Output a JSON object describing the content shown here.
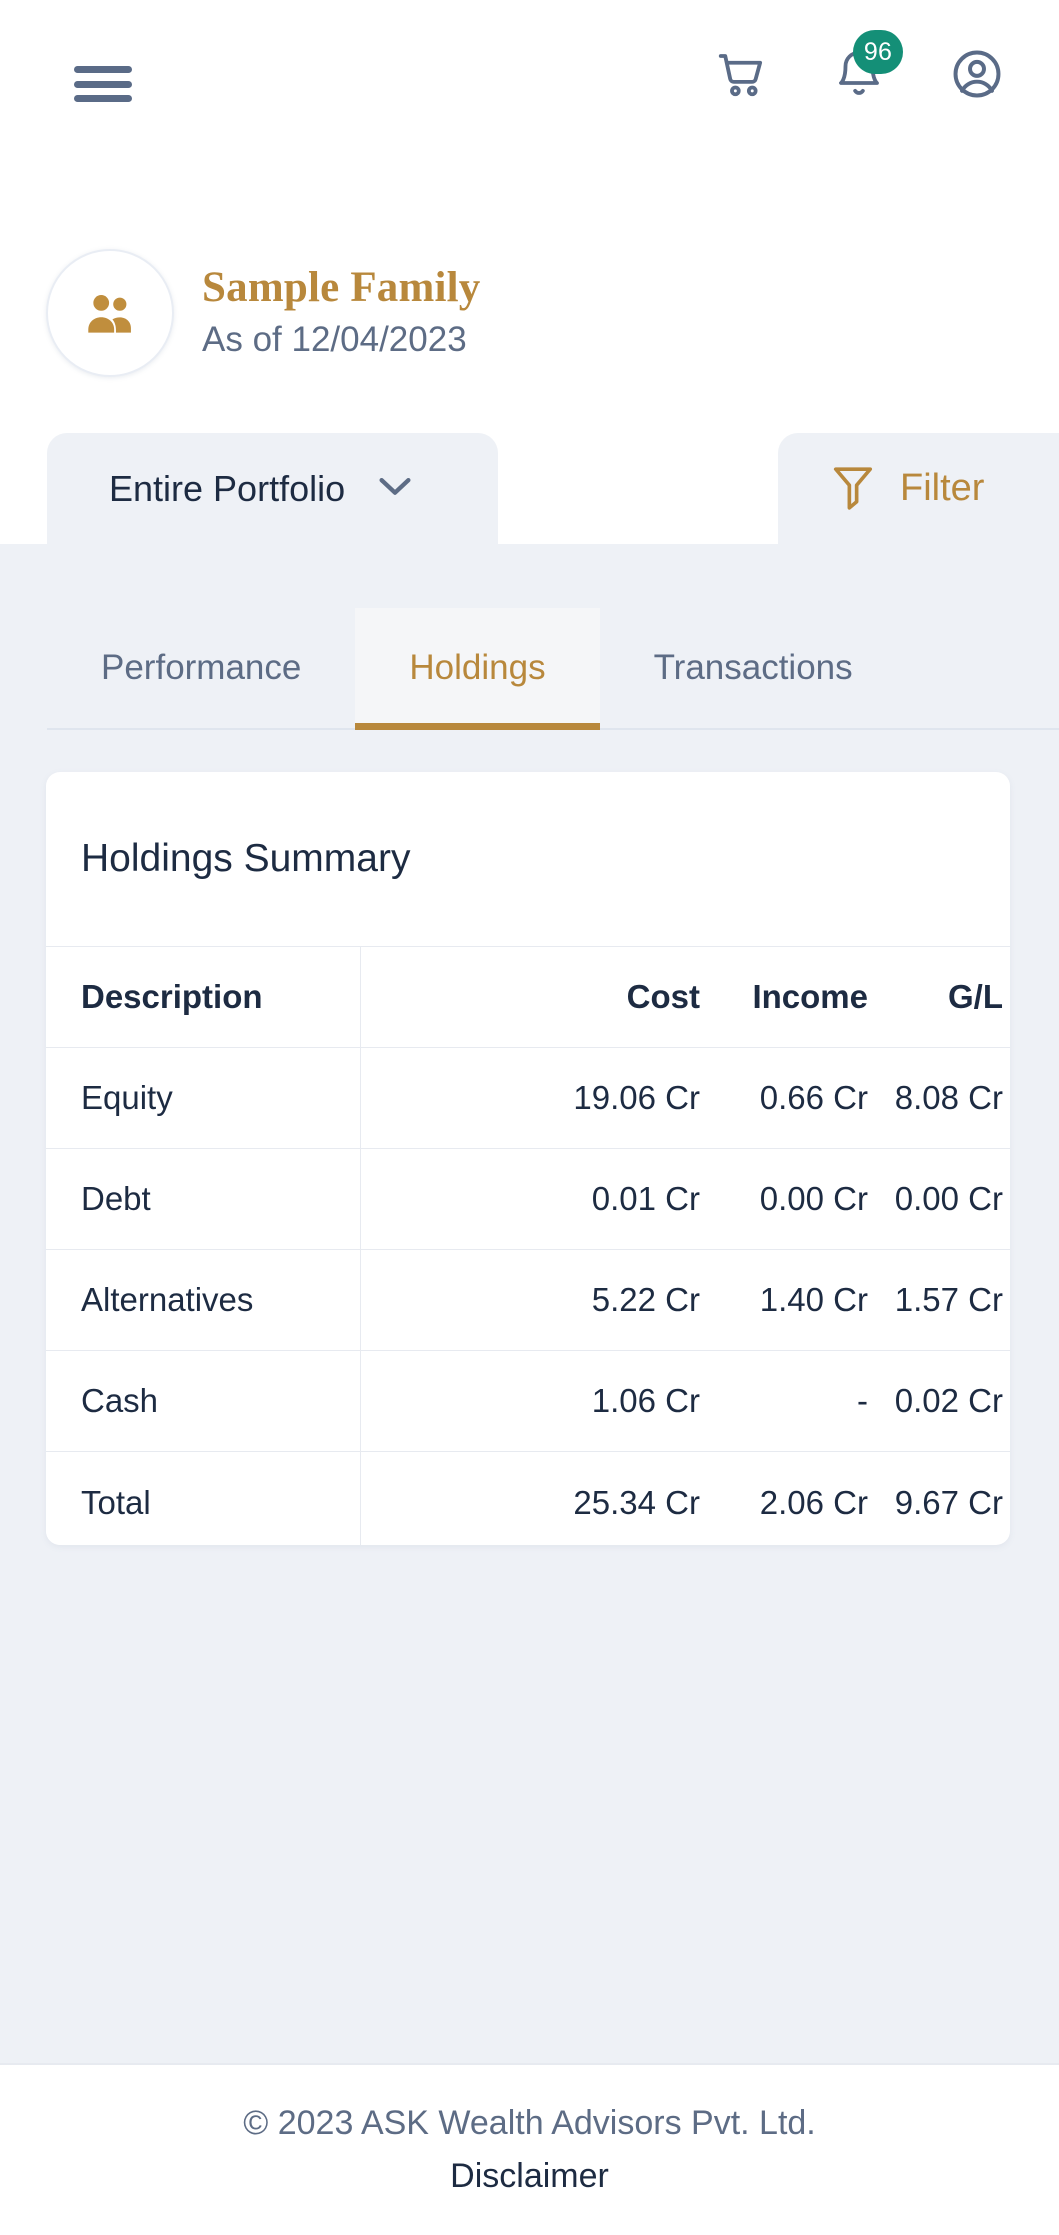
{
  "topbar": {
    "menu_icon": "hamburger-menu-icon",
    "cart_icon": "shopping-cart-icon",
    "bell_icon": "notification-bell-icon",
    "notification_count": "96",
    "account_icon": "user-account-icon",
    "badge_color": "#148f77",
    "icon_color": "#5a6b87"
  },
  "family": {
    "avatar_icon": "family-people-icon",
    "name": "Sample Family",
    "as_of": "As of 12/04/2023",
    "accent_color": "#b8883c"
  },
  "selector": {
    "portfolio_label": "Entire Portfolio",
    "chevron_icon": "chevron-down-icon",
    "filter_label": "Filter",
    "filter_icon": "filter-funnel-icon"
  },
  "tabs": [
    {
      "label": "Performance",
      "active": false
    },
    {
      "label": "Holdings",
      "active": true
    },
    {
      "label": "Transactions",
      "active": false
    }
  ],
  "holdings": {
    "title": "Holdings Summary",
    "columns": [
      "Description",
      "Cost",
      "Income",
      "G/L"
    ],
    "rows": [
      {
        "description": "Equity",
        "cost": "19.06 Cr",
        "income": "0.66 Cr",
        "gl": "8.08 Cr"
      },
      {
        "description": "Debt",
        "cost": "0.01 Cr",
        "income": "0.00 Cr",
        "gl": "0.00 Cr"
      },
      {
        "description": "Alternatives",
        "cost": "5.22 Cr",
        "income": "1.40 Cr",
        "gl": "1.57 Cr"
      },
      {
        "description": "Cash",
        "cost": "1.06 Cr",
        "income": "-",
        "gl": "0.02 Cr"
      },
      {
        "description": "Total",
        "cost": "25.34 Cr",
        "income": "2.06 Cr",
        "gl": "9.67 Cr"
      }
    ]
  },
  "footer": {
    "copyright": "© 2023 ASK Wealth Advisors Pvt. Ltd.",
    "disclaimer": "Disclaimer"
  }
}
